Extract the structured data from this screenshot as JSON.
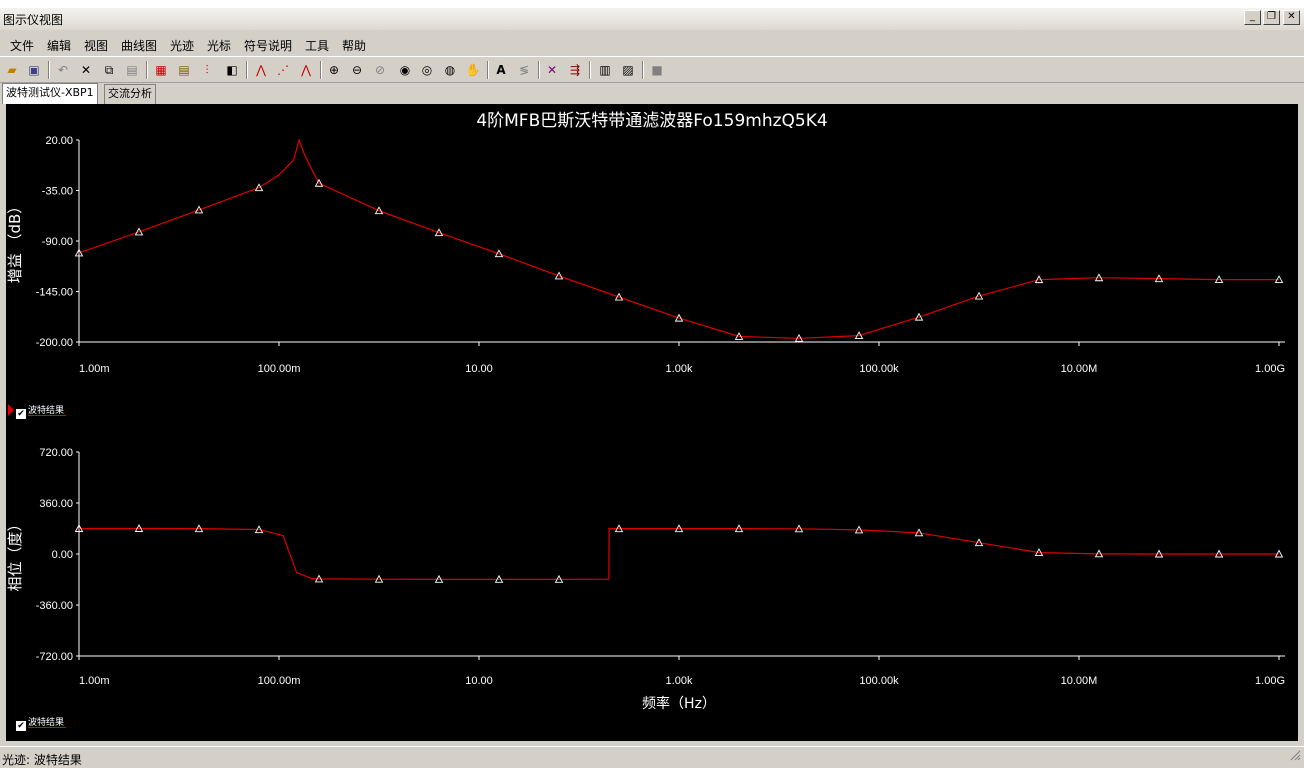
{
  "window": {
    "title": "图示仪视图",
    "minimize": "_",
    "restore": "❐",
    "close": "✕"
  },
  "menu": [
    "文件",
    "编辑",
    "视图",
    "曲线图",
    "光迹",
    "光标",
    "符号说明",
    "工具",
    "帮助"
  ],
  "toolbar_icons": [
    "open-icon",
    "save-icon",
    "undo-icon",
    "cut-icon",
    "copy-icon",
    "paste-icon",
    "grid-icon",
    "legend-icon",
    "properties-icon",
    "overlay-icon",
    "trace-icon",
    "cursor-icon",
    "data-marker-icon",
    "zoom-area-icon",
    "zoom-in-icon",
    "zoom-out-icon",
    "zoom-full-icon",
    "pan-icon",
    "hand-icon",
    "text-icon",
    "label-icon",
    "graph-icon",
    "export-icon",
    "print-icon",
    "print-preview-icon",
    "stop-icon"
  ],
  "tabs": [
    {
      "label": "波特测试仪-XBP1",
      "active": true
    },
    {
      "label": "交流分析",
      "active": false
    }
  ],
  "colors": {
    "trace": "#e00000",
    "axis": "#ffffff",
    "background": "#000000"
  },
  "legend_label": "波特结果",
  "status": {
    "text": "光迹: 波特结果"
  },
  "chart_data": [
    {
      "type": "line",
      "title": "4阶MFB巴斯沃特带通滤波器Fo159mhzQ5K4",
      "xlabel": "",
      "ylabel": "增益 （dB）",
      "xscale": "log",
      "xlim": [
        0.001,
        1000000000
      ],
      "ylim": [
        -200,
        20
      ],
      "x_ticks": [
        "1.00m",
        "100.00m",
        "10.00",
        "1.00k",
        "100.00k",
        "10.00M",
        "1.00G"
      ],
      "y_ticks": [
        "20.00",
        "-35.00",
        "-90.00",
        "-145.00",
        "-200.00"
      ],
      "series": [
        {
          "name": "波特结果",
          "x": [
            0.001,
            0.004,
            0.016,
            0.063,
            0.1,
            0.14,
            0.159,
            0.18,
            0.25,
            1,
            4,
            16,
            63,
            250,
            1000,
            4000,
            16000,
            63000,
            250000,
            1000000,
            4000000,
            16000000,
            63000000,
            250000000,
            1000000000
          ],
          "y": [
            -103,
            -80,
            -56,
            -32,
            -18,
            -2,
            20,
            4,
            -27,
            -57,
            -81,
            -104,
            -128,
            -151,
            -174,
            -194,
            -196,
            -193,
            -173,
            -150,
            -132,
            -130,
            -131,
            -132,
            -132
          ]
        }
      ]
    },
    {
      "type": "line",
      "xlabel": "频率（Hz）",
      "ylabel": "相位（度）",
      "xscale": "log",
      "xlim": [
        0.001,
        1000000000
      ],
      "ylim": [
        -720,
        720
      ],
      "x_ticks": [
        "1.00m",
        "100.00m",
        "10.00",
        "1.00k",
        "100.00k",
        "10.00M",
        "1.00G"
      ],
      "y_ticks": [
        "720.00",
        "360.00",
        "0.00",
        "-360.00",
        "-720.00"
      ],
      "series": [
        {
          "name": "波特结果",
          "x": [
            0.001,
            0.004,
            0.016,
            0.063,
            0.11,
            0.15,
            0.21,
            0.25,
            1,
            4,
            16,
            63,
            199,
            200,
            250,
            1000,
            4000,
            16000,
            63000,
            250000,
            1000000,
            4000000,
            16000000,
            63000000,
            250000000,
            1000000000
          ],
          "y": [
            180,
            180,
            179,
            172,
            130,
            -130,
            -172,
            -176,
            -178,
            -179,
            -179,
            -179,
            -178,
            180,
            179,
            179,
            179,
            178,
            170,
            150,
            80,
            10,
            1,
            0,
            0,
            0
          ]
        }
      ]
    }
  ]
}
